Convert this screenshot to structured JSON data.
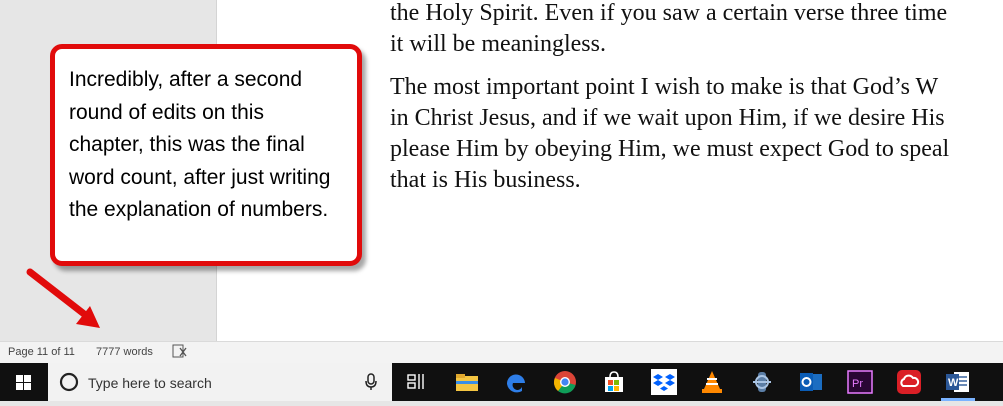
{
  "document": {
    "line1": "the Holy Spirit.  Even if you saw a certain verse three time",
    "line2": "it will be meaningless.",
    "line3": "The most important point I wish to make is that God’s W",
    "line4": "in Christ Jesus, and if we wait upon Him, if we desire His",
    "line5": "please Him by obeying Him, we must expect God to speal",
    "line6": "that is His business."
  },
  "callout": {
    "text": "Incredibly, after a second round of edits on this chapter, this was the final word count, after just writing the explanation of numbers."
  },
  "statusbar": {
    "page": "Page 11 of 11",
    "words": "7777 words"
  },
  "taskbar": {
    "search_placeholder": "Type here to search",
    "icons": [
      "windows-start-icon",
      "search-circle-icon",
      "microphone-icon",
      "task-view-icon",
      "file-explorer-icon",
      "edge-icon",
      "chrome-icon",
      "store-icon",
      "dropbox-icon",
      "vlc-icon",
      "app-icon",
      "outlook-icon",
      "premiere-icon",
      "creative-cloud-icon",
      "word-icon"
    ]
  },
  "colors": {
    "callout_border": "#e10b0b",
    "arrow": "#e10b0b",
    "taskbar": "#101010"
  }
}
